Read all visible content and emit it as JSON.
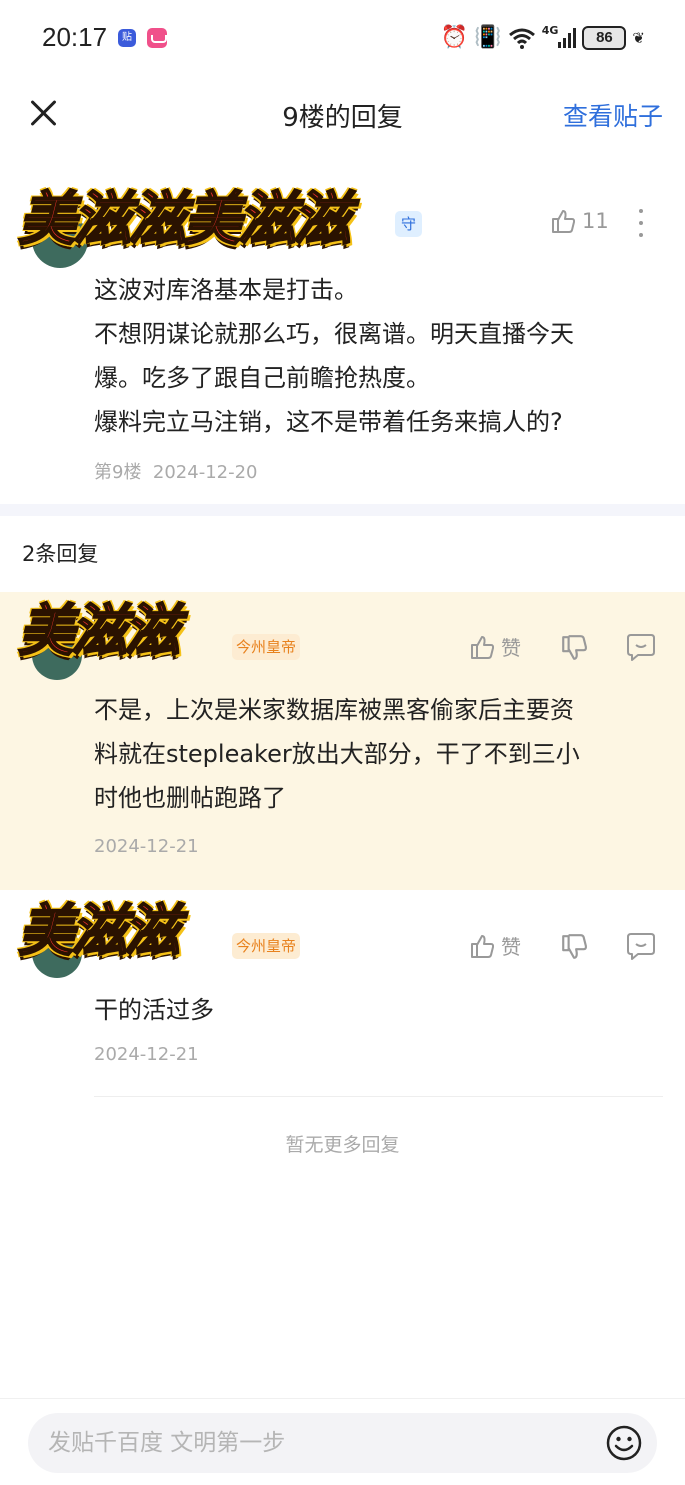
{
  "status_bar": {
    "time": "20:17",
    "app_icon_1": "贴",
    "network": "4G",
    "battery": "86"
  },
  "header": {
    "title": "9楼的回复",
    "view_post": "查看贴子"
  },
  "main_post": {
    "username_sticker": "美滋滋美滋滋",
    "badge": "守",
    "like_count": "11",
    "lines": [
      "这波对库洛基本是打击。",
      "不想阴谋论就那么巧，很离谱。明天直播今天",
      "爆。吃多了跟自己前瞻抢热度。",
      "爆料完立马注销，这不是带着任务来搞人的?"
    ],
    "floor": "第9楼",
    "date": "2024-12-20"
  },
  "replies_header": "2条回复",
  "replies": [
    {
      "username_sticker": "美滋滋",
      "badge": "今州皇帝",
      "like_label": "赞",
      "lines": [
        "不是，上次是米家数据库被黑客偷家后主要资",
        "料就在stepleaker放出大部分，干了不到三小",
        "时他也删帖跑路了"
      ],
      "date": "2024-12-21"
    },
    {
      "username_sticker": "美滋滋",
      "badge": "今州皇帝",
      "like_label": "赞",
      "lines": [
        "干的活过多"
      ],
      "date": "2024-12-21"
    }
  ],
  "no_more": "暂无更多回复",
  "composer": {
    "placeholder": "发贴千百度 文明第一步"
  },
  "icons": {
    "close": "close-icon",
    "like": "thumbs-up-icon",
    "dislike": "thumbs-down-icon",
    "comment": "comment-icon",
    "more": "more-vertical-icon",
    "emoji": "emoji-icon"
  },
  "colors": {
    "link": "#2f6fdc",
    "highlight_bg": "#fdf6e3",
    "badge_orange": "#e8821e"
  }
}
